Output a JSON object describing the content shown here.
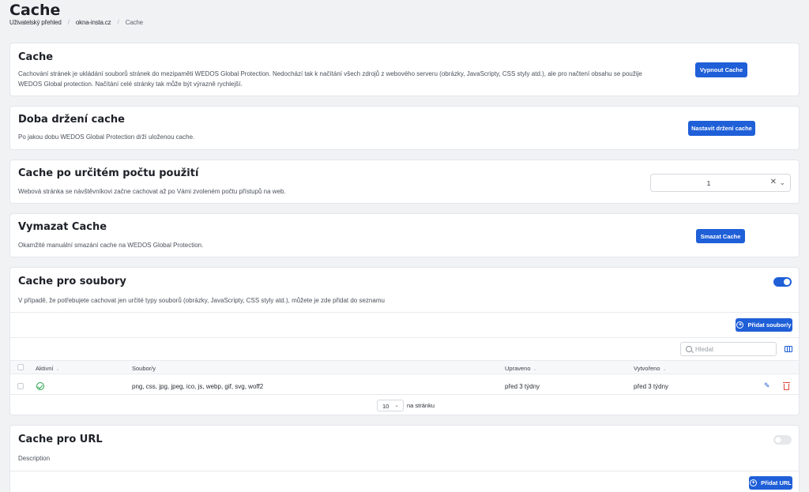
{
  "page": {
    "title": "Cache",
    "breadcrumb": [
      "Uživatelský přehled",
      "okna-insta.cz",
      "Cache"
    ]
  },
  "cards": {
    "cache": {
      "title": "Cache",
      "desc_line1": "Cachování stránek je ukládání souborů stránek do mezipaměti WEDOS Global Protection. Nedochází tak k načítání všech zdrojů z webového serveru (obrázky, JavaScripty, CSS styly atd.), ale pro načtení obsahu se použije",
      "desc_line2": "WEDOS Global protection. Načítání celé stránky tak může být výrazně rychlejší.",
      "button": "Vypnout Cache"
    },
    "retention": {
      "title": "Doba držení cache",
      "desc": "Po jakou dobu WEDOS Global Protection drží uloženou cache.",
      "button": "Nastavit držení cache"
    },
    "usage": {
      "title": "Cache po určitém počtu použití",
      "desc": "Webová stránka se návštěvníkovi začne cachovat až po Vámi zvoleném počtu přístupů na web.",
      "select_value": "1"
    },
    "purge": {
      "title": "Vymazat Cache",
      "desc": "Okamžité manuální smazání cache na WEDOS Global Protection.",
      "button": "Smazat Cache"
    },
    "files": {
      "title": "Cache pro soubory",
      "desc": "V případě, že potřebujete cachovat jen určité typy souborů (obrázky, JavaScripty, CSS styly atd.), můžete je zde přidat do seznamu",
      "toggle_on": true,
      "add_button": "Přidat soubor/y",
      "search_placeholder": "Hledat",
      "columns": [
        "Aktivní",
        "Soubor/y",
        "Upraveno",
        "Vytvořeno"
      ],
      "rows": [
        {
          "active": true,
          "files": "png, css, jpg, jpeg, ico, js, webp, gif, svg, woff2",
          "modified": "před 3 týdny",
          "created": "před 3 týdny"
        }
      ],
      "page_size": "10",
      "page_size_label": "na stránku"
    },
    "url": {
      "title": "Cache pro URL",
      "desc": "Description",
      "toggle_on": false,
      "add_button": "Přidat URL"
    }
  },
  "colors": {
    "primary": "#1f5fd8",
    "success": "#27a24a",
    "danger": "#e0443a",
    "background": "#f1f2f4"
  }
}
